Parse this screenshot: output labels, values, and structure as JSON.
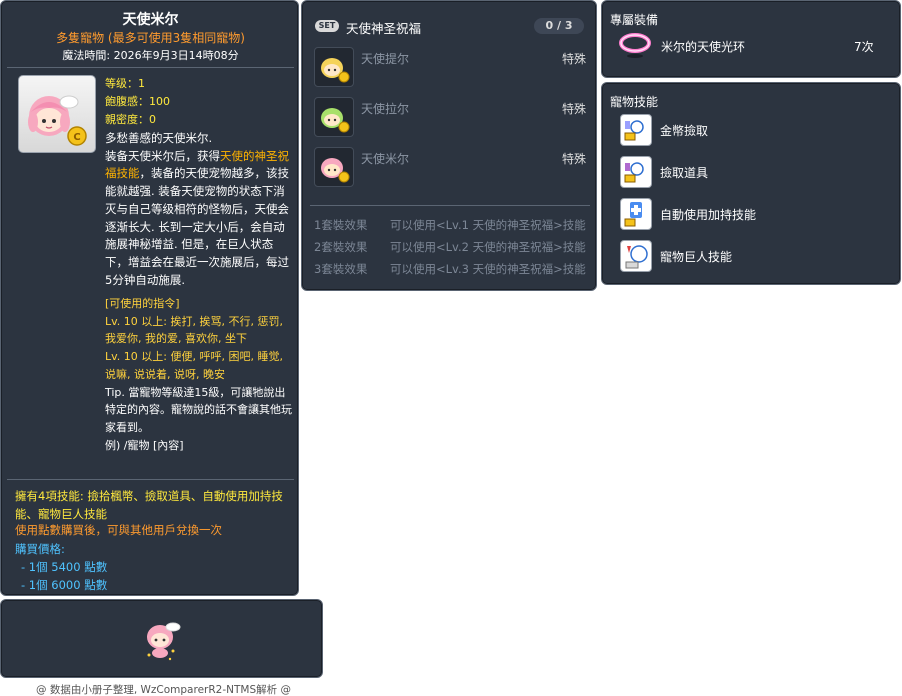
{
  "item_id": "05000292",
  "main": {
    "title": "天使米尔",
    "subtitle": "多隻寵物 (最多可使用3隻相同寵物)",
    "magic_time": "魔法時間:  2026年9月3日14時08分",
    "stats": {
      "level": "等级：1",
      "fullness": "飽腹感：100",
      "closeness": "親密度：0"
    },
    "description": {
      "line1": "多愁善感的天使米尔.",
      "part_a": "装备天使米尔后，获得",
      "highlight": "天使的神圣祝福技能",
      "part_b": "，装备的天使宠物越多，该技能就越强. 装备天使宠物的状态下消灭与自己等级相符的怪物后，天使会逐渐长大. 长到一定大小后，会自动施展神秘增益. 但是，在巨人状态下，增益会在最近一次施展后，每过5分钟自动施展."
    },
    "commands": {
      "header": "[可使用的指令]",
      "lv10_a": "Lv. 10 以上:  挨打, 挨骂, 不行, 惩罚, 我爱你, 我的爱, 喜欢你, 坐下",
      "lv10_b": "Lv. 10 以上:  便便, 呼呼, 困吧, 睡觉, 说嘛, 说说着, 说呀, 晚安",
      "tip": "Tip. 當寵物等級達15級，可讓牠說出特定的內容。寵物說的話不會讓其他玩家看到。",
      "example": "例) /寵物 [內容]"
    },
    "skills_line": "擁有4項技能: 撿拾楓幣、撿取道具、自動使用加持技能、寵物巨人技能",
    "use_line": "使用點數購買後，可與其他用戶兌換一次",
    "price_header": "購買價格:",
    "prices": [
      "- 1個 5400 點數",
      "- 1個 6000 點數"
    ]
  },
  "set": {
    "badge": "SET",
    "title": "天使神圣祝福",
    "count": "0 / 3",
    "items": [
      {
        "name": "天使提尔",
        "type": "特殊"
      },
      {
        "name": "天使拉尔",
        "type": "特殊"
      },
      {
        "name": "天使米尔",
        "type": "特殊"
      }
    ],
    "effects": [
      {
        "label": "1套裝效果",
        "text": "可以使用<Lv.1 天使的神圣祝福>技能"
      },
      {
        "label": "2套裝效果",
        "text": "可以使用<Lv.2 天使的神圣祝福>技能"
      },
      {
        "label": "3套裝效果",
        "text": "可以使用<Lv.3 天使的神圣祝福>技能"
      }
    ]
  },
  "exclusive": {
    "title": "專屬裝備",
    "name": "米尔的天使光环",
    "qty": "7次"
  },
  "pet_skills": {
    "title": "寵物技能",
    "items": [
      "金幣撿取",
      "撿取道具",
      "自動使用加持技能",
      "寵物巨人技能"
    ]
  },
  "footer": "@ 数据由小册子整理, WzComparerR2-NTMS解析 @",
  "colors": {
    "panel_bg": "#2c3440",
    "title": "#ffffff",
    "subtitle_orange": "#ff9b2e",
    "stat_yellow": "#ffe93d",
    "highlight": "#ffb300",
    "price_blue": "#4fc3ff",
    "dim_text": "#7d8796"
  }
}
